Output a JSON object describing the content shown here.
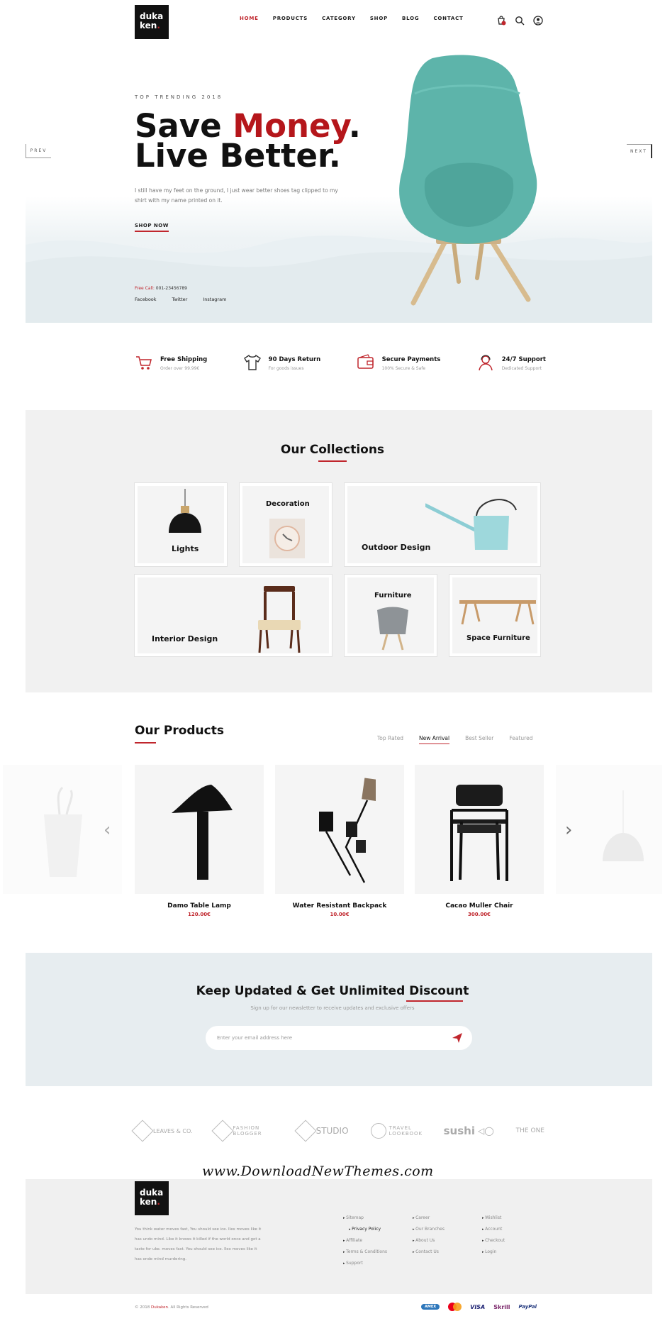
{
  "header": {
    "logo_line1": "duka",
    "logo_line2": "ken",
    "nav": [
      "HOME",
      "PRODUCTS",
      "CATEGORY",
      "SHOP",
      "BLOG",
      "CONTACT"
    ]
  },
  "hero": {
    "eyebrow": "TOP TRENDING 2018",
    "title_part1": "Save ",
    "title_red": "Money",
    "title_dot": ".",
    "title_line2": "Live Better.",
    "paragraph": "I still have my feet on the ground, I just wear better shoes tag clipped to my shirt with my name printed on it.",
    "cta": "SHOP NOW",
    "free_call_label": "Free Call:",
    "free_call_number": "001-23456789",
    "socials": [
      "Facebook",
      "Twitter",
      "Instagram"
    ],
    "prev": "PREV",
    "next": "NEXT"
  },
  "features": [
    {
      "title": "Free Shipping",
      "sub": "Order over 99.99€",
      "icon": "cart-icon"
    },
    {
      "title": "90 Days Return",
      "sub": "For goods issues",
      "icon": "tshirt-icon"
    },
    {
      "title": "Secure Payments",
      "sub": "100% Secure & Safe",
      "icon": "wallet-icon"
    },
    {
      "title": "24/7 Support",
      "sub": "Dedicated Support",
      "icon": "support-icon"
    }
  ],
  "collections": {
    "title": "Our Collections",
    "items": [
      "Lights",
      "Decoration",
      "Outdoor Design",
      "Interior Design",
      "Furniture",
      "Space Furniture"
    ]
  },
  "products": {
    "title": "Our Products",
    "tabs": [
      "Top Rated",
      "New Arrival",
      "Best Seller",
      "Featured"
    ],
    "items": [
      {
        "name": "Damo Table Lamp",
        "price": "120.00€"
      },
      {
        "name": "Water Resistant Backpack",
        "price": "10.00€"
      },
      {
        "name": "Cacao Muller Chair",
        "price": "300.00€"
      }
    ]
  },
  "newsletter": {
    "title_part1": "Keep Updated & Get Unlimited ",
    "title_part2": "Discount",
    "subtitle": "Sign up for our newsletter to receive updates and exclusive offers",
    "placeholder": "Enter your email address here"
  },
  "brands": [
    "LEAVES & CO.",
    "FASHION BLOGGER",
    "STUDIO",
    "TRAVEL LOOKBOOK",
    "sushi",
    "THE ONE"
  ],
  "watermark": "www.DownloadNewThemes.com",
  "footer": {
    "description": "You think water moves fast, You should see ice. Ilex moves like it has undo mind. Like it knows it killed if the world once and got a taste for uke. moves fast. You should see ice. Ilex moves like it has onde mind murdering.",
    "col1": [
      "Sitemap",
      "Privacy Policy",
      "Affiliate",
      "Terms & Conditions",
      "Support"
    ],
    "col2": [
      "Career",
      "Our Branches",
      "About Us",
      "Contact Us"
    ],
    "col3": [
      "Wishlist",
      "Account",
      "Checkout",
      "Login"
    ],
    "copyright_pre": "© 2018 ",
    "copyright_brand": "Dukaken",
    "copyright_post": ". All Rights Reserved",
    "payments": [
      "AMEX",
      "VISA",
      "Skrill",
      "PayPal"
    ]
  },
  "colors": {
    "accent": "#c0262d",
    "chair": "#5fb5ab",
    "newsletter_bg": "#e7edf0"
  }
}
